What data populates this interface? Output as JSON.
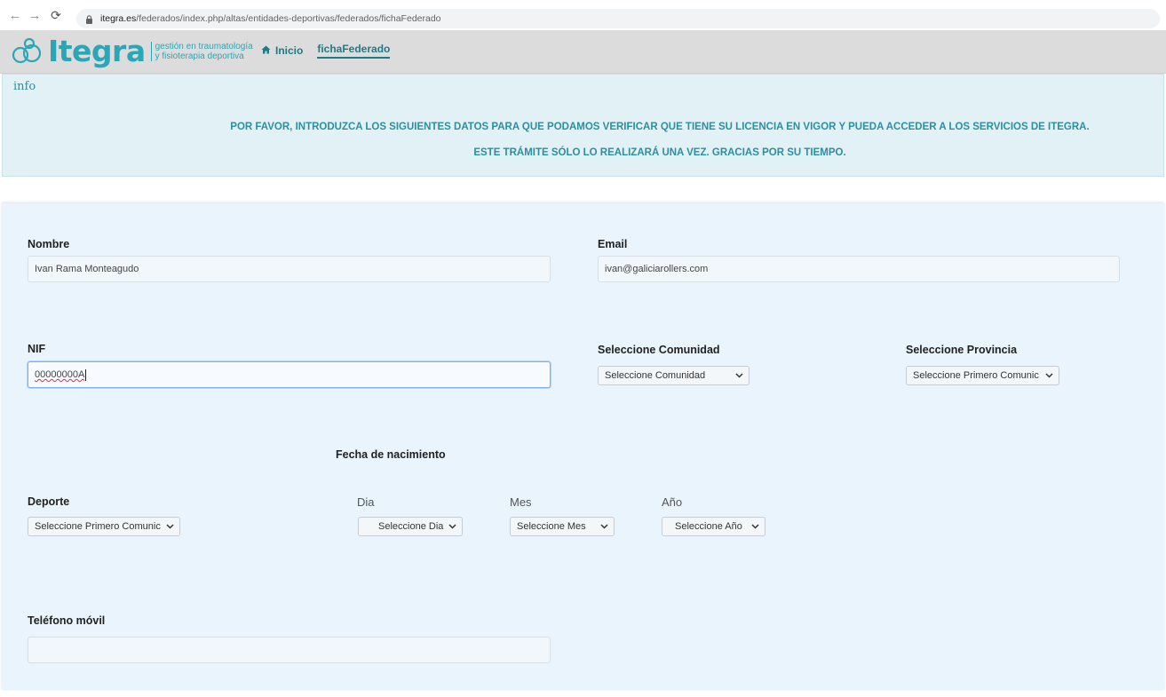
{
  "browser": {
    "url_host": "itegra.es",
    "url_path": "/federados/index.php/altas/entidades-deportivas/federados/fichaFederado"
  },
  "header": {
    "logo_text": "Itegra",
    "tagline_line1": "gestión en traumatología",
    "tagline_line2": "y fisioterapia deportiva",
    "nav_home": "Inicio",
    "nav_current": "fichaFederado"
  },
  "info": {
    "title": "info",
    "line1": "POR FAVOR, INTRODUZCA LOS SIGUIENTES DATOS PARA QUE PODAMOS VERIFICAR QUE TIENE SU LICENCIA EN VIGOR Y PUEDA ACCEDER A LOS SERVICIOS DE ITEGRA.",
    "line2": "ESTE TRÁMITE SÓLO LO REALIZARÁ UNA VEZ. GRACIAS POR SU TIEMPO."
  },
  "form": {
    "nombre": {
      "label": "Nombre",
      "value": "Ivan Rama Monteagudo"
    },
    "email": {
      "label": "Email",
      "value": "ivan@galiciarollers.com"
    },
    "nif": {
      "label": "NIF",
      "value": "00000000A"
    },
    "comunidad": {
      "label": "Seleccione Comunidad",
      "selected": "Seleccione Comunidad"
    },
    "provincia": {
      "label": "Seleccione Provincia",
      "selected": "Seleccione Primero Comunic"
    },
    "fecha_title": "Fecha de nacimiento",
    "deporte": {
      "label": "Deporte",
      "selected": "Seleccione Primero Comunic"
    },
    "dia": {
      "label": "Dia",
      "selected": "Seleccione Dia"
    },
    "mes": {
      "label": "Mes",
      "selected": "Seleccione Mes"
    },
    "anio": {
      "label": "Año",
      "selected": "Seleccione Año"
    },
    "telefono": {
      "label": "Teléfono móvil",
      "value": ""
    }
  },
  "colors": {
    "brand": "#2aa6b6",
    "info_bg": "#e1f1f5",
    "form_bg": "#e9f4fd"
  },
  "icons": {
    "back": "arrow-left-icon",
    "forward": "arrow-right-icon",
    "reload": "reload-icon",
    "lock": "lock-icon",
    "home": "home-icon",
    "select": "chevron-down-icon"
  }
}
